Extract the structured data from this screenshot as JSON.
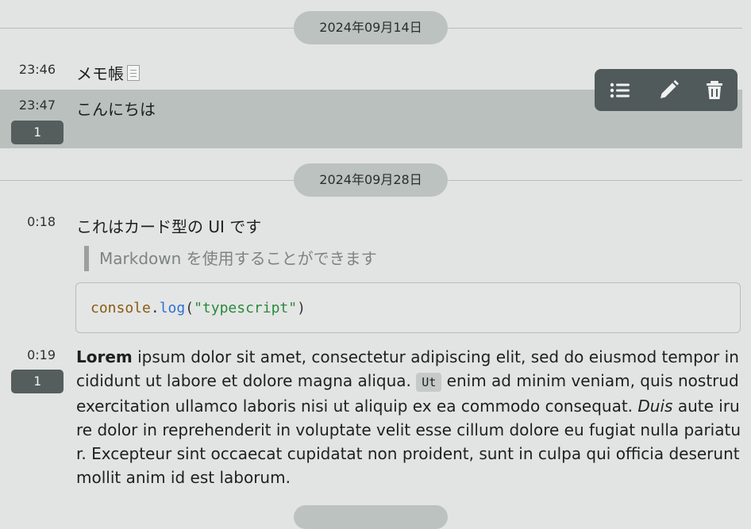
{
  "dates": [
    "2024年09月14日",
    "2024年09月28日"
  ],
  "messages": [
    {
      "time": "23:46",
      "text": "メモ帳",
      "icon": "memo-icon"
    },
    {
      "time": "23:47",
      "text": "こんにちは",
      "badge": "1"
    },
    {
      "time": "0:18",
      "text": "これはカード型の UI です",
      "quote": "Markdown を使用することができます",
      "code": {
        "obj": "console",
        "dot": ".",
        "fn": "log",
        "open": "(",
        "str": "\"typescript\"",
        "close": ")"
      }
    },
    {
      "time": "0:19",
      "badge": "1",
      "para": {
        "bold": "Lorem",
        "part1": " ipsum dolor sit amet, consectetur adipiscing elit, sed do eiusmod tempor incididunt ut labore et dolore magna aliqua. ",
        "code": "Ut",
        "part2": " enim ad minim veniam, quis nostrud exercitation ullamco laboris nisi ut aliquip ex ea commodo consequat. ",
        "italic": "Duis",
        "part3": " aute irure dolor in reprehenderit in voluptate velit esse cillum dolore eu fugiat nulla pariatur. Excepteur sint occaecat cupidatat non proident, sunt in culpa qui officia deserunt mollit anim id est laborum."
      }
    }
  ],
  "toolbar": {
    "icons": [
      "list-icon",
      "pencil-icon",
      "trash-icon"
    ]
  }
}
